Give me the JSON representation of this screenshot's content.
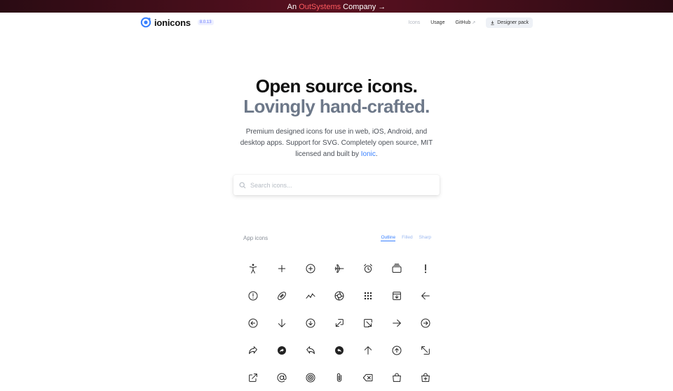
{
  "banner": {
    "prefix": "An",
    "brand": "OutSystems",
    "suffix": "Company →"
  },
  "nav": {
    "logo_text": "ionicons",
    "version": "8.0.13",
    "links": [
      "Icons",
      "Usage",
      "GitHub"
    ],
    "github_ext": "↗",
    "designer_pack": "Designer pack"
  },
  "hero": {
    "title": "Open source icons.",
    "subtitle": "Lovingly hand-crafted.",
    "desc_before": "Premium designed icons for use in web, iOS, Android, and desktop apps. Support for SVG. Completely open source, MIT licensed and built by ",
    "desc_link": "Ionic",
    "desc_after": "."
  },
  "search": {
    "placeholder": "Search icons..."
  },
  "section": {
    "title": "App icons",
    "filters": [
      "Outline",
      "Filled",
      "Sharp"
    ],
    "active_filter": "Outline"
  },
  "colors": {
    "accent": "#3880ff",
    "brand_red": "#ff5a5f"
  },
  "icons": [
    "accessibility-icon",
    "add-icon",
    "add-circle-icon",
    "airplane-icon",
    "alarm-icon",
    "albums-icon",
    "alert-icon",
    "alert-circle-icon",
    "american-football-icon",
    "analytics-icon",
    "aperture-icon",
    "apps-icon",
    "archive-icon",
    "arrow-back-icon",
    "arrow-back-circle-icon",
    "arrow-down-icon",
    "arrow-down-circle-icon",
    "arrow-down-left-box-icon",
    "arrow-down-right-box-icon",
    "arrow-forward-icon",
    "arrow-forward-circle-icon",
    "arrow-redo-icon",
    "arrow-redo-circle-icon",
    "arrow-undo-icon",
    "arrow-undo-circle-icon",
    "arrow-up-icon",
    "arrow-up-circle-icon",
    "arrow-up-left-box-icon",
    "arrow-up-right-box-icon",
    "at-icon",
    "at-circle-icon",
    "attach-icon",
    "backspace-icon",
    "bag-icon",
    "bag-add-icon"
  ]
}
